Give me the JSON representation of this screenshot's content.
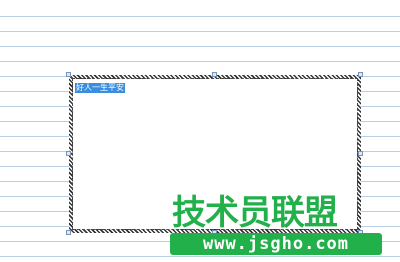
{
  "document": {
    "textbox_text": "好人一生平安"
  },
  "watermark": {
    "title": "技术员联盟",
    "url": "www.jsgho.com"
  },
  "colors": {
    "ruled_line": "#b9cfe4",
    "selection_highlight": "#3a8ee0",
    "watermark_green": "#22b04a"
  }
}
